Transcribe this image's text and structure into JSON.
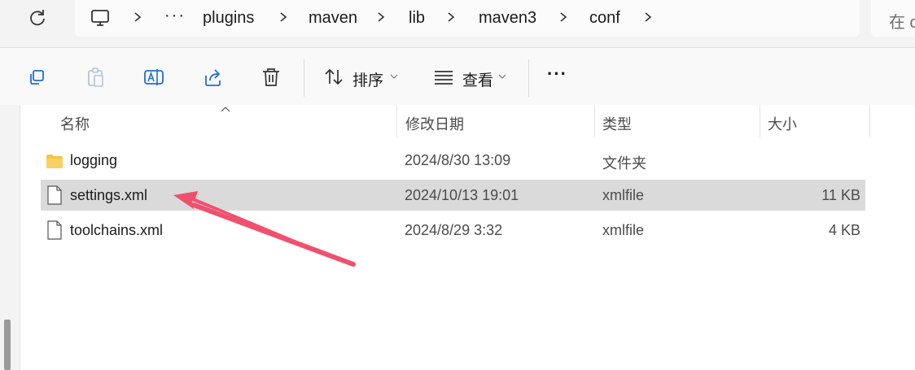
{
  "breadcrumb": {
    "overflow_label": "···",
    "items": [
      "plugins",
      "maven",
      "lib",
      "maven3",
      "conf"
    ]
  },
  "search": {
    "placeholder": "在 c"
  },
  "toolbar": {
    "sort_label": "排序",
    "view_label": "查看",
    "more_label": "···"
  },
  "columns": {
    "name": "名称",
    "date": "修改日期",
    "type": "类型",
    "size": "大小"
  },
  "files": [
    {
      "name": "logging",
      "date": "2024/8/30 13:09",
      "type": "文件夹",
      "size": "",
      "icon": "folder-icon",
      "selected": false
    },
    {
      "name": "settings.xml",
      "date": "2024/10/13 19:01",
      "type": "xmlfile",
      "size": "11 KB",
      "icon": "file-icon",
      "selected": true
    },
    {
      "name": "toolchains.xml",
      "date": "2024/8/29 3:32",
      "type": "xmlfile",
      "size": "4 KB",
      "icon": "file-icon",
      "selected": false
    }
  ],
  "colors": {
    "selection": "#dadada",
    "annotation_arrow": "#f0506e",
    "folder": "#f5c542"
  }
}
